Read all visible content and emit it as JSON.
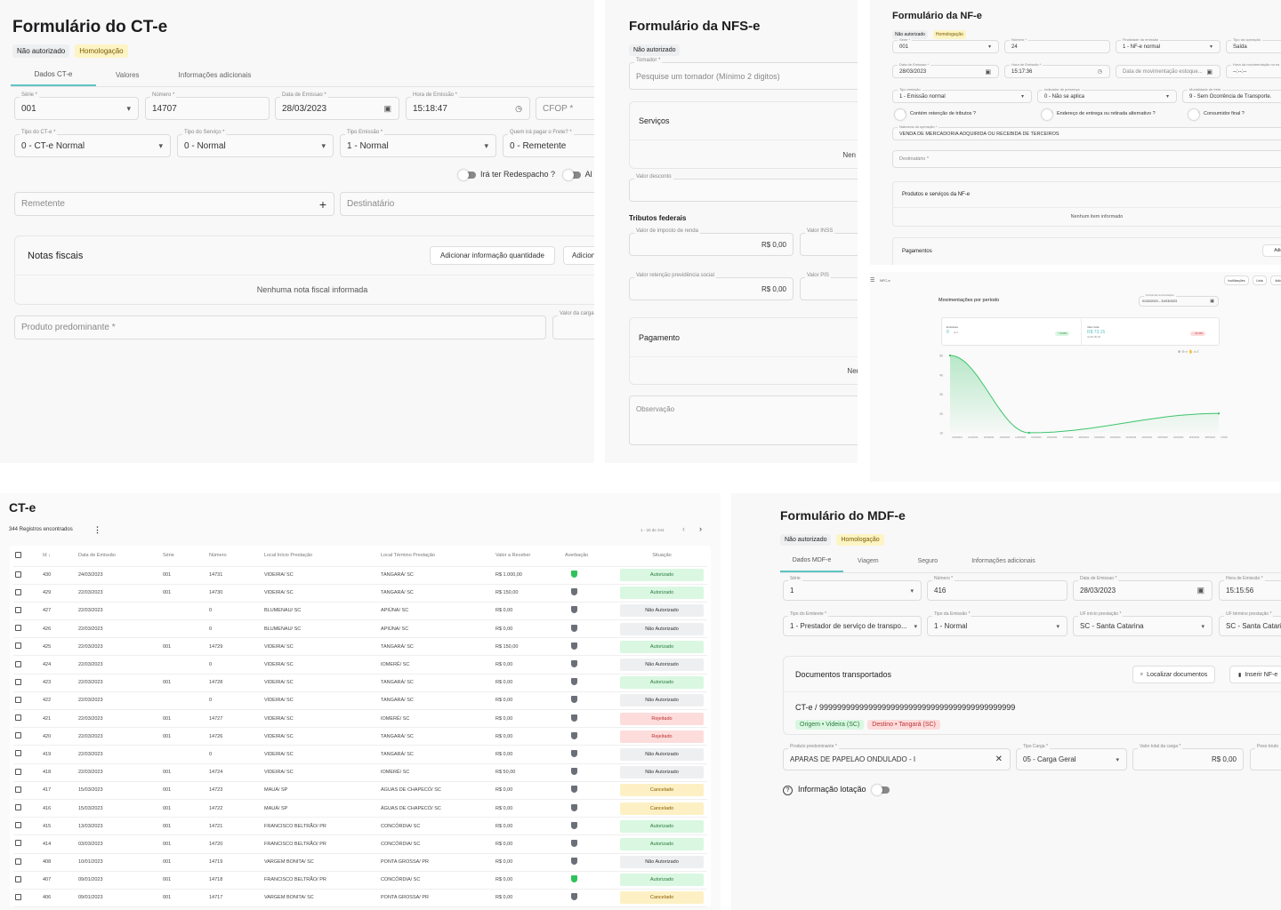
{
  "cte_form": {
    "title": "Formulário do CT-e",
    "badges": [
      "Não autorizado",
      "Homologação"
    ],
    "tabs": [
      "Dados CT-e",
      "Valores",
      "Informações adicionais"
    ],
    "fields": {
      "serie": {
        "label": "Série *",
        "value": "001"
      },
      "numero": {
        "label": "Número *",
        "value": "14707"
      },
      "data_emissao": {
        "label": "Data de Emissao *",
        "value": "28/03/2023"
      },
      "hora_emissao": {
        "label": "Hora de Emissão *",
        "value": "15:18:47"
      },
      "cfop": {
        "placeholder": "CFOP *"
      },
      "tipo_cte": {
        "label": "Tipo do CT-e *",
        "value": "0 - CT-e Normal"
      },
      "tipo_servico": {
        "label": "Tipo do Serviço *",
        "value": "0 - Normal"
      },
      "tipo_emissao": {
        "label": "Tipo Emissão *",
        "value": "1 - Normal"
      },
      "pagador_frete": {
        "label": "Quem irá pagar o Frete? *",
        "value": "0 - Remetente"
      },
      "remetente": {
        "placeholder": "Remetente"
      },
      "destinatario": {
        "placeholder": "Destinatário"
      },
      "produto_predominante": {
        "placeholder": "Produto predominante *"
      },
      "valor_carga": {
        "label": "Valor da carga"
      }
    },
    "toggles": [
      "Irá ter Redespacho ?",
      "Al"
    ],
    "notas": {
      "title": "Notas fiscais",
      "buttons": [
        "Adicionar informação quantidade",
        "Adicion"
      ],
      "empty": "Nenhuma nota fiscal informada"
    }
  },
  "nfse_form": {
    "title": "Formulário da NFS-e",
    "badge": "Não autorizado",
    "tomador": {
      "label": "Tomador *",
      "placeholder": "Pesquise um tomador (Mínimo 2 digitos)"
    },
    "servicos": {
      "title": "Serviços",
      "empty": "Nen"
    },
    "valor_desconto": {
      "label": "Valor desconto",
      "value": "R"
    },
    "tributos": {
      "title": "Tributos federais",
      "ir": {
        "label": "Valor de imposto de renda",
        "value": "R$ 0,00"
      },
      "inss": {
        "label": "Valor INSS"
      },
      "previdencia": {
        "label": "Valor retenção previdência social",
        "value": "R$ 0,00"
      },
      "pis": {
        "label": "Valor PIS"
      }
    },
    "pagamento": {
      "title": "Pagamento",
      "empty": "Nenhu"
    },
    "observacao": {
      "placeholder": "Observação"
    }
  },
  "nfe_form": {
    "title": "Formulário da NF-e",
    "badges": [
      "Não autorizado",
      "Homologação"
    ],
    "fields": {
      "serie": {
        "label": "Série *",
        "value": "001"
      },
      "numero": {
        "label": "Número *",
        "value": "24"
      },
      "finalidade": {
        "label": "Finalidade da emissão",
        "value": "1 - NF-e normal"
      },
      "tipo_operacao": {
        "label": "Tipo da operação",
        "value": "Saída"
      },
      "data_emissao": {
        "label": "Data de Emissao *",
        "value": "28/03/2023"
      },
      "hora_emissao": {
        "label": "Hora de Emissão *",
        "value": "15:17:36"
      },
      "data_mov": {
        "placeholder": "Data de movimentação estoque..."
      },
      "hora_mov": {
        "label": "Hora da movimentação no es",
        "value": "--:--:--"
      },
      "tipo_emissao": {
        "label": "Tipo emissão",
        "value": "1 - Emissão normal"
      },
      "indicador_presenca": {
        "label": "Indicador de presença",
        "value": "0 - Não se aplica"
      },
      "modalidade_frete": {
        "label": "Modalidade de frete",
        "value": "9 - Sem Ocorrência de Transporte."
      },
      "natureza": {
        "label": "Natureza da operação *",
        "value": "VENDA DE MERCADORIA ADQUIRIDA OU RECEBIDA DE TERCEIROS"
      },
      "destinatario": {
        "placeholder": "Destinatário *"
      }
    },
    "toggles": [
      "Contém retenção de tributos ?",
      "Endereço de entrega ou retirada alternativo ?",
      "Consumidor final ?"
    ],
    "produtos": {
      "title": "Produtos e serviços da NF-e",
      "empty": "Nenhum item informado"
    },
    "pagamentos": {
      "title": "Pagamentos",
      "button": "Adicio"
    }
  },
  "nfce_dashboard": {
    "app_label": "NFC-e",
    "header_buttons": [
      "Inutilizações",
      "Lista",
      "Adicio"
    ],
    "title": "Movimentações por período",
    "period": {
      "label": "Período das movimentações",
      "value": "01/03/2023 – 31/03/2023"
    },
    "emissoes": {
      "label": "Emissões",
      "value": "8",
      "sub": "de 6",
      "delta": "↑ 33,33%"
    },
    "valor_total": {
      "label": "Valor total",
      "value": "R$ 73,15",
      "sub": "de R$ 153,45",
      "delta": "↓ -52,33%"
    },
    "accent": "#5ec4c4",
    "line_color": "#3cc46a"
  },
  "chart_data": {
    "type": "area",
    "title": "Movimentações por período",
    "x": [
      "10/03/2023",
      "11/03/2023",
      "12/03/2023",
      "13/03/2023",
      "14/03/2023",
      "15/03/2023",
      "16/03/2023",
      "17/03/2023",
      "18/03/2023",
      "19/03/2023",
      "20/03/2023",
      "21/03/2023",
      "22/03/2023",
      "23/03/2023",
      "24/03/2023",
      "25/03/2023",
      "26/03/2023",
      "27/03/2023"
    ],
    "points": [
      {
        "x": "10/03/2023",
        "y": 50
      },
      {
        "x": "15/03/2023",
        "y": 10
      },
      {
        "x": "27/03/2023",
        "y": 20
      }
    ],
    "yticks": [
      10,
      20,
      30,
      40,
      50
    ],
    "ylim": [
      10,
      50
    ],
    "xlabel": "",
    "ylabel": "",
    "grid": false
  },
  "cte_list": {
    "title": "CT-e",
    "count": "344 Registros encontrados",
    "pagination": "1 - 20 de 344",
    "columns": [
      "Id ↓",
      "Data de Emissão",
      "Série",
      "Número",
      "Local Início Prestação",
      "Local Término Prestação",
      "Valor a Receber",
      "Averbação",
      "Situação"
    ],
    "rows": [
      {
        "id": "430",
        "data": "24/03/2023",
        "serie": "001",
        "numero": "14731",
        "inicio": "VIDEIRA/ SC",
        "termino": "TANGARÁ/ SC",
        "valor": "R$ 1.000,00",
        "averbado": true,
        "situacao": "Autorizado",
        "tipo": "aut"
      },
      {
        "id": "429",
        "data": "22/03/2023",
        "serie": "001",
        "numero": "14730",
        "inicio": "VIDEIRA/ SC",
        "termino": "TANGARÁ/ SC",
        "valor": "R$ 150,00",
        "averbado": false,
        "situacao": "Autorizado",
        "tipo": "aut"
      },
      {
        "id": "427",
        "data": "22/03/2023",
        "serie": "",
        "numero": "0",
        "inicio": "BLUMENAU/ SC",
        "termino": "APIÚNA/ SC",
        "valor": "R$ 0,00",
        "averbado": false,
        "situacao": "Não Autorizado",
        "tipo": "nao"
      },
      {
        "id": "426",
        "data": "22/03/2023",
        "serie": "",
        "numero": "0",
        "inicio": "BLUMENAU/ SC",
        "termino": "APIÚNA/ SC",
        "valor": "R$ 0,00",
        "averbado": false,
        "situacao": "Não Autorizado",
        "tipo": "nao"
      },
      {
        "id": "425",
        "data": "22/03/2023",
        "serie": "001",
        "numero": "14729",
        "inicio": "VIDEIRA/ SC",
        "termino": "TANGARÁ/ SC",
        "valor": "R$ 150,00",
        "averbado": false,
        "situacao": "Autorizado",
        "tipo": "aut"
      },
      {
        "id": "424",
        "data": "22/03/2023",
        "serie": "",
        "numero": "0",
        "inicio": "VIDEIRA/ SC",
        "termino": "IOMERÊ/ SC",
        "valor": "R$ 0,00",
        "averbado": false,
        "situacao": "Não Autorizado",
        "tipo": "nao"
      },
      {
        "id": "423",
        "data": "22/03/2023",
        "serie": "001",
        "numero": "14728",
        "inicio": "VIDEIRA/ SC",
        "termino": "TANGARÁ/ SC",
        "valor": "R$ 0,00",
        "averbado": false,
        "situacao": "Autorizado",
        "tipo": "aut"
      },
      {
        "id": "422",
        "data": "22/03/2023",
        "serie": "",
        "numero": "0",
        "inicio": "VIDEIRA/ SC",
        "termino": "TANGARÁ/ SC",
        "valor": "R$ 0,00",
        "averbado": false,
        "situacao": "Não Autorizado",
        "tipo": "nao"
      },
      {
        "id": "421",
        "data": "22/03/2023",
        "serie": "001",
        "numero": "14727",
        "inicio": "VIDEIRA/ SC",
        "termino": "IOMERÊ/ SC",
        "valor": "R$ 0,00",
        "averbado": false,
        "situacao": "Rejeitado",
        "tipo": "rej"
      },
      {
        "id": "420",
        "data": "22/03/2023",
        "serie": "001",
        "numero": "14726",
        "inicio": "VIDEIRA/ SC",
        "termino": "TANGARÁ/ SC",
        "valor": "R$ 0,00",
        "averbado": false,
        "situacao": "Rejeitado",
        "tipo": "rej"
      },
      {
        "id": "419",
        "data": "22/03/2023",
        "serie": "",
        "numero": "0",
        "inicio": "VIDEIRA/ SC",
        "termino": "TANGARÁ/ SC",
        "valor": "R$ 0,00",
        "averbado": false,
        "situacao": "Não Autorizado",
        "tipo": "nao"
      },
      {
        "id": "418",
        "data": "22/03/2023",
        "serie": "001",
        "numero": "14724",
        "inicio": "VIDEIRA/ SC",
        "termino": "IOMERÊ/ SC",
        "valor": "R$ 50,00",
        "averbado": false,
        "situacao": "Não Autorizado",
        "tipo": "nao"
      },
      {
        "id": "417",
        "data": "15/03/2023",
        "serie": "001",
        "numero": "14723",
        "inicio": "MAUÁ/ SP",
        "termino": "ÁGUAS DE CHAPECÓ/ SC",
        "valor": "R$ 0,00",
        "averbado": false,
        "situacao": "Cancelado",
        "tipo": "can"
      },
      {
        "id": "416",
        "data": "15/03/2023",
        "serie": "001",
        "numero": "14722",
        "inicio": "MAUÁ/ SP",
        "termino": "ÁGUAS DE CHAPECÓ/ SC",
        "valor": "R$ 0,00",
        "averbado": false,
        "situacao": "Cancelado",
        "tipo": "can"
      },
      {
        "id": "415",
        "data": "13/03/2023",
        "serie": "001",
        "numero": "14721",
        "inicio": "FRANCISCO BELTRÃO/ PR",
        "termino": "CONCÓRDIA/ SC",
        "valor": "R$ 0,00",
        "averbado": false,
        "situacao": "Autorizado",
        "tipo": "aut"
      },
      {
        "id": "414",
        "data": "03/03/2023",
        "serie": "001",
        "numero": "14720",
        "inicio": "FRANCISCO BELTRÃO/ PR",
        "termino": "CONCÓRDIA/ SC",
        "valor": "R$ 0,00",
        "averbado": false,
        "situacao": "Autorizado",
        "tipo": "aut"
      },
      {
        "id": "408",
        "data": "10/01/2023",
        "serie": "001",
        "numero": "14719",
        "inicio": "VARGEM BONITA/ SC",
        "termino": "PONTA GROSSA/ PR",
        "valor": "R$ 0,00",
        "averbado": false,
        "situacao": "Não Autorizado",
        "tipo": "nao"
      },
      {
        "id": "407",
        "data": "09/01/2023",
        "serie": "001",
        "numero": "14718",
        "inicio": "FRANCISCO BELTRÃO/ PR",
        "termino": "CONCÓRDIA/ SC",
        "valor": "R$ 0,00",
        "averbado": true,
        "situacao": "Autorizado",
        "tipo": "aut"
      },
      {
        "id": "406",
        "data": "09/01/2023",
        "serie": "001",
        "numero": "14717",
        "inicio": "VARGEM BONITA/ SC",
        "termino": "PONTA GROSSA/ PR",
        "valor": "R$ 0,00",
        "averbado": false,
        "situacao": "Cancelado",
        "tipo": "can"
      }
    ]
  },
  "mdfe_form": {
    "title": "Formulário do MDF-e",
    "badges": [
      "Não autorizado",
      "Homologação"
    ],
    "tabs": [
      "Dados MDF-e",
      "Viagem",
      "Seguro",
      "Informações adicionais"
    ],
    "fields": {
      "serie": {
        "label": "Série",
        "value": "1"
      },
      "numero": {
        "label": "Número *",
        "value": "416"
      },
      "data_emissao": {
        "label": "Data de Emissao *",
        "value": "28/03/2023"
      },
      "hora_emissao": {
        "label": "Hora de Emissão *",
        "value": "15:15:56"
      },
      "tipo_emitente": {
        "label": "Tipo do Emitente *",
        "value": "1 - Prestador de serviço de transpo..."
      },
      "tipo_emissao": {
        "label": "Tipo da Emissão *",
        "value": "1 - Normal"
      },
      "uf_inicio": {
        "label": "UF início prestação *",
        "value": "SC - Santa Catarina"
      },
      "uf_termino": {
        "label": "UF término prestação *",
        "value": "SC - Santa Catarina"
      },
      "produto": {
        "label": "Produto predominante *",
        "value": "APARAS DE PAPELAO ONDULADO - I"
      },
      "tipo_carga": {
        "label": "Tipo Carga *",
        "value": "05 - Carga Geral"
      },
      "valor_carga": {
        "label": "Valor total da carga *",
        "value": "R$ 0,00"
      },
      "peso_bruto": {
        "label": "Peso bruto"
      }
    },
    "documentos": {
      "title": "Documentos transportados",
      "buttons": [
        "Localizar documentos",
        "Inserir NF-e"
      ],
      "doc": "CT-e / 99999999999999999999999999999999999999999999",
      "origem": "Origem • Videira (SC)",
      "destino": "Destino • Tangará (SC)"
    },
    "lotacao": "Informação lotação"
  }
}
